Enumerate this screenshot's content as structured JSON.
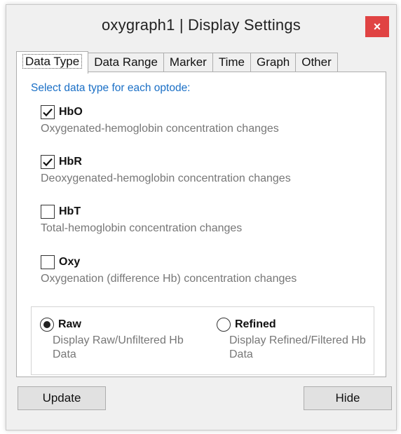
{
  "window": {
    "title": "oxygraph1 | Display Settings",
    "close_glyph": "×"
  },
  "tabs": [
    {
      "label": "Data Type",
      "active": true
    },
    {
      "label": "Data Range",
      "active": false
    },
    {
      "label": "Marker",
      "active": false
    },
    {
      "label": "Time",
      "active": false
    },
    {
      "label": "Graph",
      "active": false
    },
    {
      "label": "Other",
      "active": false
    }
  ],
  "panel": {
    "heading": "Select data type for each optode:",
    "options": [
      {
        "label": "HbO",
        "desc": "Oxygenated-hemoglobin concentration changes",
        "checked": true
      },
      {
        "label": "HbR",
        "desc": "Deoxygenated-hemoglobin concentration changes",
        "checked": true
      },
      {
        "label": "HbT",
        "desc": "Total-hemoglobin concentration changes",
        "checked": false
      },
      {
        "label": "Oxy",
        "desc": "Oxygenation (difference Hb) concentration changes",
        "checked": false
      }
    ],
    "mode": [
      {
        "label": "Raw",
        "desc": "Display Raw/Unfiltered Hb Data",
        "selected": true
      },
      {
        "label": "Refined",
        "desc": "Display Refined/Filtered Hb Data",
        "selected": false
      }
    ]
  },
  "buttons": {
    "update": "Update",
    "hide": "Hide"
  },
  "colors": {
    "heading": "#1a6fc6",
    "close_bg": "#e04343",
    "description": "#777777"
  }
}
